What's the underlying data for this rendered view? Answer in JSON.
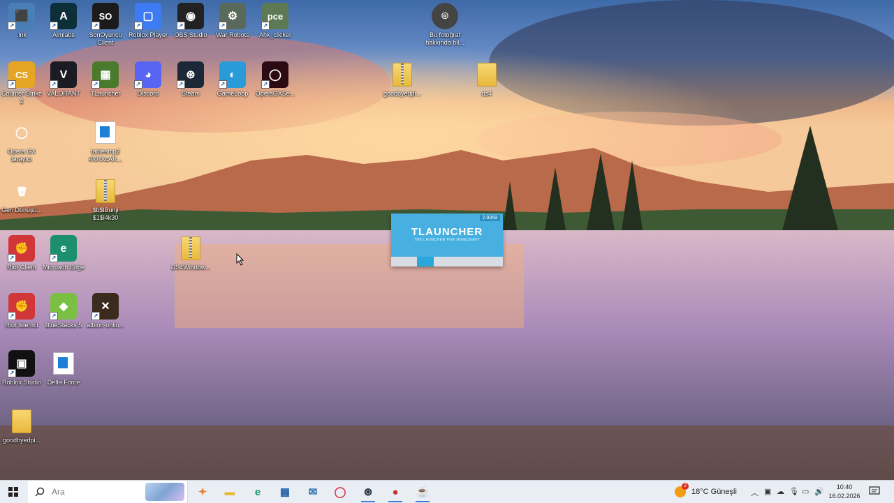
{
  "desktop": {
    "icons": [
      {
        "name": "lnk-icon",
        "label": ".lnk",
        "col": 0,
        "row": 0,
        "color": "#4a7fb5",
        "glyph": "⬛"
      },
      {
        "name": "aimlabs-icon",
        "label": "Aimlabs",
        "col": 1,
        "row": 0,
        "color": "#0d2f3a",
        "glyph": "A"
      },
      {
        "name": "sonoyuncu-icon",
        "label": "SonOyuncu Client",
        "col": 2,
        "row": 0,
        "color": "#1b1b1b",
        "glyph": "SO"
      },
      {
        "name": "roblox-player-icon",
        "label": "Roblox Player",
        "col": 3,
        "row": 0,
        "color": "#3d7bf5",
        "glyph": "▢"
      },
      {
        "name": "obs-studio-icon",
        "label": "OBS Studio",
        "col": 4,
        "row": 0,
        "color": "#222",
        "glyph": "◉"
      },
      {
        "name": "war-robots-icon",
        "label": "War Robots",
        "col": 5,
        "row": 0,
        "color": "#5a6a5a",
        "glyph": "⚙"
      },
      {
        "name": "ahk-clicker-icon",
        "label": "Ahk_clicker",
        "col": 6,
        "row": 0,
        "color": "#5d7a55",
        "glyph": "pce"
      },
      {
        "name": "counter-strike-icon",
        "label": "Counter-Strike 2",
        "col": 0,
        "row": 1,
        "color": "#e7a526",
        "glyph": "CS"
      },
      {
        "name": "valorant-icon",
        "label": "VALORANT",
        "col": 1,
        "row": 1,
        "color": "#1b1b24",
        "glyph": "V"
      },
      {
        "name": "tlauncher-icon",
        "label": "TLauncher",
        "col": 2,
        "row": 1,
        "color": "#4b7a2c",
        "glyph": "▦"
      },
      {
        "name": "discord-icon",
        "label": "Discord",
        "col": 3,
        "row": 1,
        "color": "#5865f2",
        "glyph": "◕"
      },
      {
        "name": "steam-icon",
        "label": "Steam",
        "col": 4,
        "row": 1,
        "color": "#1b2838",
        "glyph": "⊛"
      },
      {
        "name": "gameloop-icon",
        "label": "GameLoop",
        "col": 5,
        "row": 1,
        "color": "#2a9ad8",
        "glyph": "◐"
      },
      {
        "name": "operagx-setup-icon",
        "label": "OperaGXSe...",
        "col": 6,
        "row": 1,
        "color": "#2b0a14",
        "glyph": "◯"
      },
      {
        "name": "opera-gx-icon",
        "label": "Opera GX tarayıcı",
        "col": 0,
        "row": 2,
        "color": "transparent",
        "glyph": "◯"
      },
      {
        "name": "tablesmp-icon",
        "label": "tablesmp2 #XRXcAR...",
        "col": 2,
        "row": 2,
        "color": "transparent",
        "glyph": "doc"
      },
      {
        "name": "recycle-bin-icon",
        "label": "Geri Dönüşü...",
        "col": 0,
        "row": 3,
        "color": "transparent",
        "glyph": "🗑"
      },
      {
        "name": "zip-file-icon",
        "label": "$b$lBunji $1$l4k30",
        "col": 2,
        "row": 3,
        "color": "transparent",
        "glyph": "zip"
      },
      {
        "name": "riot-client-icon",
        "label": "Riot Client",
        "col": 0,
        "row": 4,
        "color": "#d13639",
        "glyph": "✊"
      },
      {
        "name": "microsoft-edge-icon",
        "label": "Microsoft Edge",
        "col": 1,
        "row": 4,
        "color": "#1c8f6f",
        "glyph": "e"
      },
      {
        "name": "ds4windows-zip-icon",
        "label": "DS4Window...",
        "col": 4,
        "row": 4,
        "color": "transparent",
        "glyph": "zip"
      },
      {
        "name": "riot-istemci-icon",
        "label": "Riot İstemci",
        "col": 0,
        "row": 5,
        "color": "#d13639",
        "glyph": "✊"
      },
      {
        "name": "bluestacks-icon",
        "label": "BlueStacks 5",
        "col": 1,
        "row": 5,
        "color": "#7bc043",
        "glyph": "◆"
      },
      {
        "name": "albion-online-icon",
        "label": "albion-onlin...",
        "col": 2,
        "row": 5,
        "color": "#3b2a1e",
        "glyph": "✕"
      },
      {
        "name": "roblox-studio-icon",
        "label": "Roblox Studio",
        "col": 0,
        "row": 6,
        "color": "#111",
        "glyph": "▣"
      },
      {
        "name": "delta-force-icon",
        "label": "Delta Force",
        "col": 1,
        "row": 6,
        "color": "transparent",
        "glyph": "doc"
      },
      {
        "name": "goodbye-folder-icon",
        "label": "goodbyedpi...",
        "col": 0,
        "row": 7,
        "color": "transparent",
        "glyph": "folder"
      }
    ],
    "extra_icons": [
      {
        "name": "photo-info-icon",
        "label": "Bu fotoğraf hakkında bil...",
        "glyph": "⌾"
      },
      {
        "name": "goodbyedpi-zip-icon",
        "label": "goodbyedpi...",
        "glyph": "zip"
      },
      {
        "name": "ds4-folder-icon",
        "label": "ds4",
        "glyph": "folder"
      }
    ]
  },
  "tlauncher_splash": {
    "title": "TLAUNCHER",
    "subtitle": "THE LAUNCHER FOR MINECRAFT",
    "version": "2.9359",
    "progress": 0.15
  },
  "taskbar": {
    "search_placeholder": "Ara",
    "apps": [
      {
        "name": "copilot-taskbar-icon",
        "glyph": "✦",
        "color": "#e8863a"
      },
      {
        "name": "file-explorer-taskbar-icon",
        "glyph": "▬",
        "color": "#e8b93c"
      },
      {
        "name": "edge-taskbar-icon",
        "glyph": "e",
        "color": "#1c8f6f"
      },
      {
        "name": "store-taskbar-icon",
        "glyph": "▦",
        "color": "#2563a8"
      },
      {
        "name": "mail-taskbar-icon",
        "glyph": "✉",
        "color": "#2b6cb0"
      },
      {
        "name": "opera-gx-taskbar-icon",
        "glyph": "◯",
        "color": "#e0304a"
      },
      {
        "name": "steam-taskbar-icon",
        "glyph": "⊛",
        "color": "#1b2838"
      },
      {
        "name": "unknown-app-taskbar-icon",
        "glyph": "●",
        "color": "#c0392b"
      },
      {
        "name": "java-taskbar-icon",
        "glyph": "☕",
        "color": "#2b6cb0"
      }
    ],
    "weather": {
      "badge": "2",
      "text": "18°C Güneşli"
    },
    "time": "10:40",
    "date": "16.02.2026"
  }
}
